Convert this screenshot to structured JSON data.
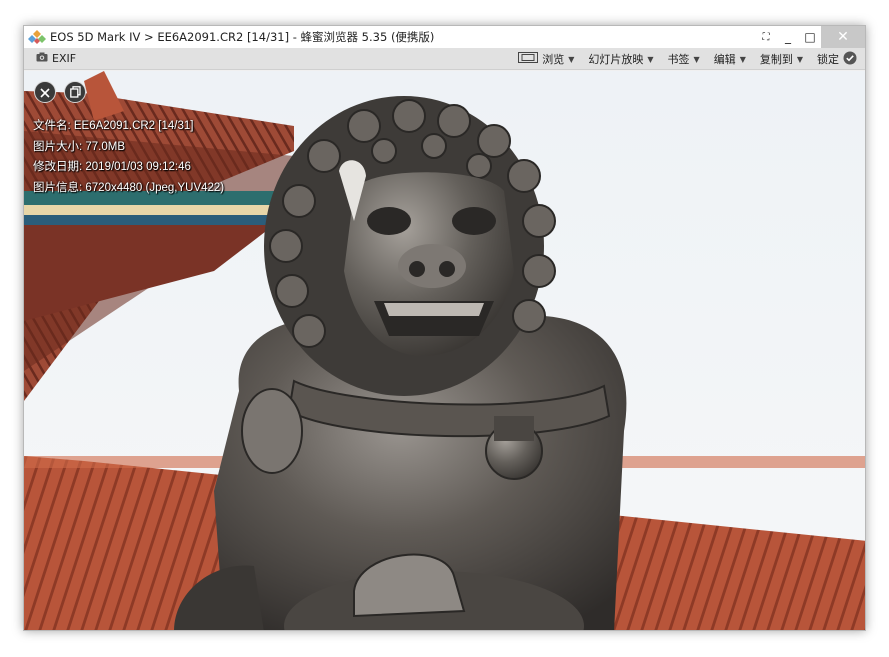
{
  "window": {
    "title": "EOS 5D Mark IV > EE6A2091.CR2 [14/31] - 蜂蜜浏览器 5.35 (便携版)",
    "controls": {
      "fullscreen": "⛶",
      "minimize": "_",
      "maximize": "□",
      "close": "✕"
    }
  },
  "toolbar": {
    "exif_label": "EXIF",
    "items": [
      {
        "label": "浏览",
        "icon": "film-frame-icon"
      },
      {
        "label": "幻灯片放映"
      },
      {
        "label": "书签"
      },
      {
        "label": "编辑"
      },
      {
        "label": "复制到"
      },
      {
        "label": "锁定",
        "icon": "check-circle-icon"
      }
    ]
  },
  "overlay": {
    "buttons": [
      {
        "icon": "close-icon"
      },
      {
        "icon": "copy-icon"
      }
    ],
    "info": [
      "文件名: EE6A2091.CR2 [14/31]",
      "图片大小: 77.0MB",
      "修改日期: 2019/01/03 09:12:46",
      "图片信息: 6720x4480 (Jpeg,YUV422)"
    ]
  },
  "colors": {
    "roof_tile": "#b5553a",
    "roof_beam": "#2a6a6a",
    "wall": "#c0503a",
    "statue": "#4f4c48",
    "sky": "#f4f6f8"
  }
}
